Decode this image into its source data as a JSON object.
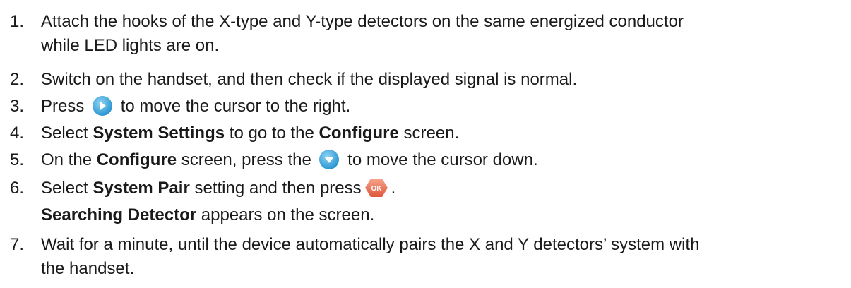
{
  "steps": [
    {
      "number": "1.",
      "line1": "Attach the hooks of the X-type and Y-type detectors on the same energized conductor",
      "line2": "while LED lights are on."
    },
    {
      "number": "2.",
      "text": "Switch on the handset, and then check if the displayed signal is normal."
    },
    {
      "number": "3.",
      "before": "Press",
      "after": "to move the cursor to the right.",
      "icon": "right-arrow-button-icon"
    },
    {
      "number": "4.",
      "before": "Select",
      "bold1": "System Settings",
      "middle": "to go to the",
      "bold2": "Configure",
      "after": "screen."
    },
    {
      "number": "5.",
      "before": "On the",
      "bold1": "Configure",
      "middle": "screen, press the",
      "after": "to move the cursor down.",
      "icon": "down-arrow-button-icon"
    },
    {
      "number": "6.",
      "before": "Select",
      "bold1": "System Pair",
      "middle": "setting and then press",
      "after": ".",
      "icon": "ok-button-icon",
      "icon_label": "OK",
      "line2_bold": "Searching Detector",
      "line2_after": "appears on the screen."
    },
    {
      "number": "7.",
      "line1": "Wait for a minute, until the device automatically pairs the X and Y detectors’ system with",
      "line2": "the handset."
    }
  ],
  "colors": {
    "text": "#1a1a1a",
    "arrow_button": "#3aa6dd",
    "ok_button": "#e8684a"
  }
}
